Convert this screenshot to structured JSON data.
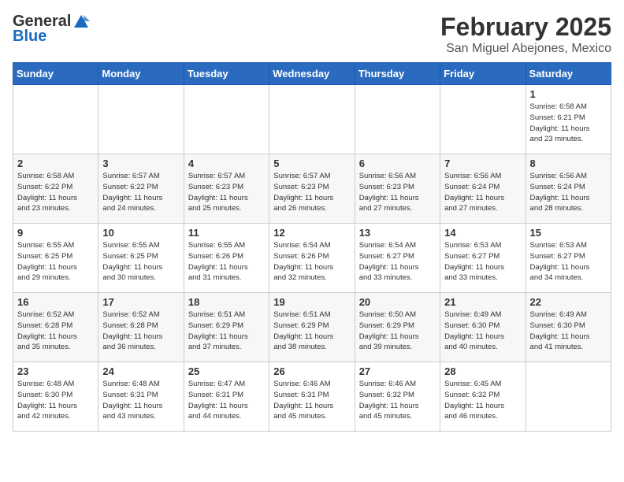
{
  "header": {
    "logo_general": "General",
    "logo_blue": "Blue",
    "month_title": "February 2025",
    "location": "San Miguel Abejones, Mexico"
  },
  "weekdays": [
    "Sunday",
    "Monday",
    "Tuesday",
    "Wednesday",
    "Thursday",
    "Friday",
    "Saturday"
  ],
  "weeks": [
    [
      {
        "day": "",
        "info": ""
      },
      {
        "day": "",
        "info": ""
      },
      {
        "day": "",
        "info": ""
      },
      {
        "day": "",
        "info": ""
      },
      {
        "day": "",
        "info": ""
      },
      {
        "day": "",
        "info": ""
      },
      {
        "day": "1",
        "info": "Sunrise: 6:58 AM\nSunset: 6:21 PM\nDaylight: 11 hours\nand 23 minutes."
      }
    ],
    [
      {
        "day": "2",
        "info": "Sunrise: 6:58 AM\nSunset: 6:22 PM\nDaylight: 11 hours\nand 23 minutes."
      },
      {
        "day": "3",
        "info": "Sunrise: 6:57 AM\nSunset: 6:22 PM\nDaylight: 11 hours\nand 24 minutes."
      },
      {
        "day": "4",
        "info": "Sunrise: 6:57 AM\nSunset: 6:23 PM\nDaylight: 11 hours\nand 25 minutes."
      },
      {
        "day": "5",
        "info": "Sunrise: 6:57 AM\nSunset: 6:23 PM\nDaylight: 11 hours\nand 26 minutes."
      },
      {
        "day": "6",
        "info": "Sunrise: 6:56 AM\nSunset: 6:23 PM\nDaylight: 11 hours\nand 27 minutes."
      },
      {
        "day": "7",
        "info": "Sunrise: 6:56 AM\nSunset: 6:24 PM\nDaylight: 11 hours\nand 27 minutes."
      },
      {
        "day": "8",
        "info": "Sunrise: 6:56 AM\nSunset: 6:24 PM\nDaylight: 11 hours\nand 28 minutes."
      }
    ],
    [
      {
        "day": "9",
        "info": "Sunrise: 6:55 AM\nSunset: 6:25 PM\nDaylight: 11 hours\nand 29 minutes."
      },
      {
        "day": "10",
        "info": "Sunrise: 6:55 AM\nSunset: 6:25 PM\nDaylight: 11 hours\nand 30 minutes."
      },
      {
        "day": "11",
        "info": "Sunrise: 6:55 AM\nSunset: 6:26 PM\nDaylight: 11 hours\nand 31 minutes."
      },
      {
        "day": "12",
        "info": "Sunrise: 6:54 AM\nSunset: 6:26 PM\nDaylight: 11 hours\nand 32 minutes."
      },
      {
        "day": "13",
        "info": "Sunrise: 6:54 AM\nSunset: 6:27 PM\nDaylight: 11 hours\nand 33 minutes."
      },
      {
        "day": "14",
        "info": "Sunrise: 6:53 AM\nSunset: 6:27 PM\nDaylight: 11 hours\nand 33 minutes."
      },
      {
        "day": "15",
        "info": "Sunrise: 6:53 AM\nSunset: 6:27 PM\nDaylight: 11 hours\nand 34 minutes."
      }
    ],
    [
      {
        "day": "16",
        "info": "Sunrise: 6:52 AM\nSunset: 6:28 PM\nDaylight: 11 hours\nand 35 minutes."
      },
      {
        "day": "17",
        "info": "Sunrise: 6:52 AM\nSunset: 6:28 PM\nDaylight: 11 hours\nand 36 minutes."
      },
      {
        "day": "18",
        "info": "Sunrise: 6:51 AM\nSunset: 6:29 PM\nDaylight: 11 hours\nand 37 minutes."
      },
      {
        "day": "19",
        "info": "Sunrise: 6:51 AM\nSunset: 6:29 PM\nDaylight: 11 hours\nand 38 minutes."
      },
      {
        "day": "20",
        "info": "Sunrise: 6:50 AM\nSunset: 6:29 PM\nDaylight: 11 hours\nand 39 minutes."
      },
      {
        "day": "21",
        "info": "Sunrise: 6:49 AM\nSunset: 6:30 PM\nDaylight: 11 hours\nand 40 minutes."
      },
      {
        "day": "22",
        "info": "Sunrise: 6:49 AM\nSunset: 6:30 PM\nDaylight: 11 hours\nand 41 minutes."
      }
    ],
    [
      {
        "day": "23",
        "info": "Sunrise: 6:48 AM\nSunset: 6:30 PM\nDaylight: 11 hours\nand 42 minutes."
      },
      {
        "day": "24",
        "info": "Sunrise: 6:48 AM\nSunset: 6:31 PM\nDaylight: 11 hours\nand 43 minutes."
      },
      {
        "day": "25",
        "info": "Sunrise: 6:47 AM\nSunset: 6:31 PM\nDaylight: 11 hours\nand 44 minutes."
      },
      {
        "day": "26",
        "info": "Sunrise: 6:46 AM\nSunset: 6:31 PM\nDaylight: 11 hours\nand 45 minutes."
      },
      {
        "day": "27",
        "info": "Sunrise: 6:46 AM\nSunset: 6:32 PM\nDaylight: 11 hours\nand 45 minutes."
      },
      {
        "day": "28",
        "info": "Sunrise: 6:45 AM\nSunset: 6:32 PM\nDaylight: 11 hours\nand 46 minutes."
      },
      {
        "day": "",
        "info": ""
      }
    ]
  ]
}
